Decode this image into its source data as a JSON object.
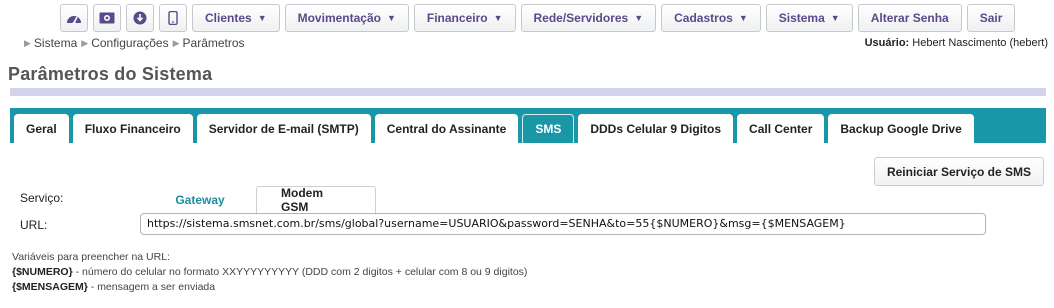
{
  "nav": {
    "icons": [
      "dashboard-icon",
      "money-icon",
      "download-icon",
      "mobile-icon"
    ],
    "menus": [
      {
        "label": "Clientes",
        "dropdown": true
      },
      {
        "label": "Movimentação",
        "dropdown": true
      },
      {
        "label": "Financeiro",
        "dropdown": true
      },
      {
        "label": "Rede/Servidores",
        "dropdown": true
      },
      {
        "label": "Cadastros",
        "dropdown": true
      },
      {
        "label": "Sistema",
        "dropdown": true
      }
    ],
    "change_password": "Alterar Senha",
    "logout": "Sair"
  },
  "breadcrumb": [
    "Sistema",
    "Configurações",
    "Parâmetros"
  ],
  "user": {
    "label": "Usuário:",
    "name": "Hebert Nascimento (hebert)"
  },
  "page_title": "Parâmetros do Sistema",
  "tabs": [
    {
      "label": "Geral",
      "active": false
    },
    {
      "label": "Fluxo Financeiro",
      "active": false
    },
    {
      "label": "Servidor de E-mail (SMTP)",
      "active": false
    },
    {
      "label": "Central do Assinante",
      "active": false
    },
    {
      "label": "SMS",
      "active": true
    },
    {
      "label": "DDDs Celular 9 Digitos",
      "active": false
    },
    {
      "label": "Call Center",
      "active": false
    },
    {
      "label": "Backup Google Drive",
      "active": false
    }
  ],
  "sms": {
    "restart_button": "Reiniciar Serviço de SMS",
    "service_label": "Serviço:",
    "service_options": [
      "Gateway",
      "Modem GSM"
    ],
    "url_label": "URL:",
    "url_value": "https://sistema.smsnet.com.br/sms/global?username=USUARIO&password=SENHA&to=55{$NUMERO}&msg={$MENSAGEM}",
    "vars_intro": "Variáveis para preencher na URL:",
    "vars": [
      {
        "name": "{$NUMERO}",
        "desc": " - número do celular no formato XXYYYYYYYYY (DDD com 2 digitos + celular com 8 ou 9 digitos)"
      },
      {
        "name": "{$MENSAGEM}",
        "desc": " - mensagem a ser enviada"
      }
    ]
  },
  "colors": {
    "accent": "#1a97a7",
    "nav_text": "#5a4a8a",
    "title_bar": "#d3d3ee"
  }
}
